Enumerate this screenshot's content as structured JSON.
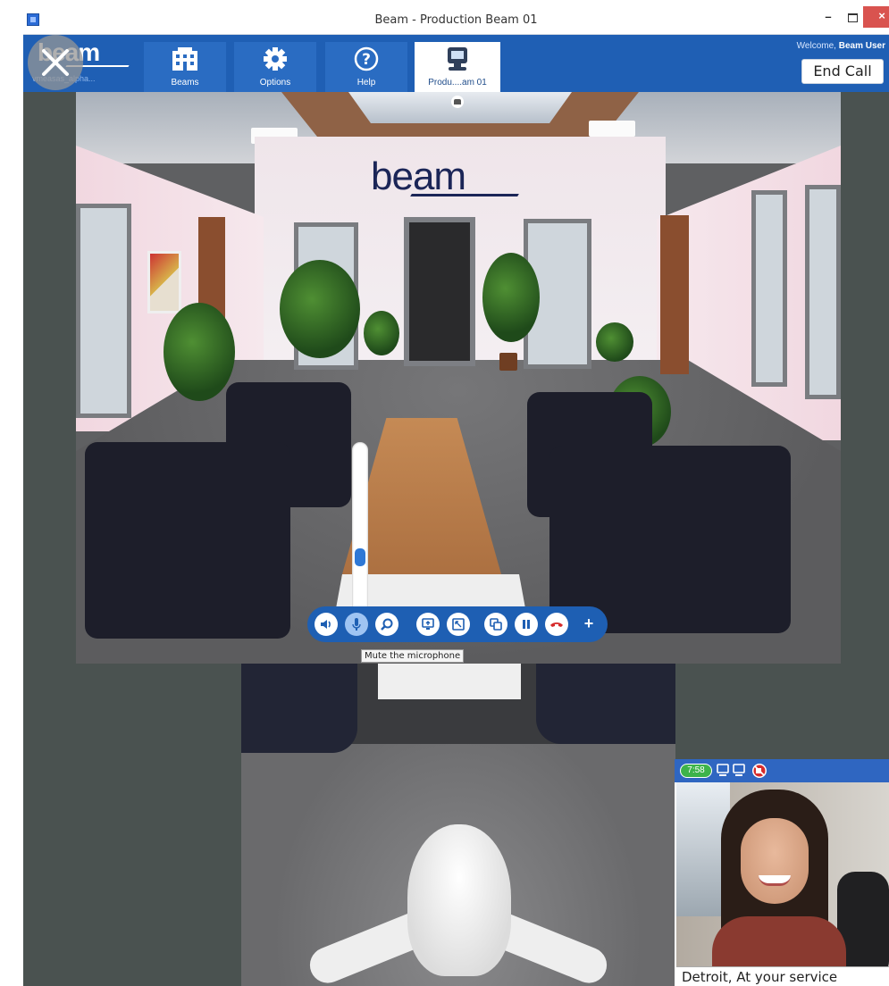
{
  "window": {
    "title": "Beam - Production Beam 01",
    "minimize": "–",
    "close": "×"
  },
  "toolbar": {
    "logo": "beam",
    "user_handle": "vmeasas_alpha...",
    "tabs": [
      {
        "label": "Beams",
        "icon": "building-icon"
      },
      {
        "label": "Options",
        "icon": "gear-icon"
      },
      {
        "label": "Help",
        "icon": "help-icon"
      },
      {
        "label": "Produ....am 01",
        "icon": "beam-robot-icon"
      }
    ],
    "welcome_prefix": "Welcome,",
    "welcome_user": "Beam User",
    "end_call_label": "End Call"
  },
  "scene": {
    "brand_sign": "beam"
  },
  "controls": {
    "mic_level": 0.33,
    "buttons": [
      {
        "name": "speaker",
        "icon": "speaker-icon"
      },
      {
        "name": "microphone",
        "icon": "microphone-icon",
        "active": true
      },
      {
        "name": "zoom",
        "icon": "zoom-icon"
      },
      {
        "name": "screen-share",
        "icon": "screen-share-icon"
      },
      {
        "name": "fullscreen",
        "icon": "fullscreen-icon"
      },
      {
        "name": "camera-swap",
        "icon": "camera-swap-icon"
      },
      {
        "name": "pause",
        "icon": "pause-icon"
      },
      {
        "name": "hang-up",
        "icon": "hang-up-icon"
      }
    ],
    "tooltip": "Mute the microphone"
  },
  "preview": {
    "timer": "7:58",
    "caption": "Detroit, At your service"
  },
  "colors": {
    "toolbar_blue": "#1f5fb4",
    "active_tab": "#ffffff",
    "timer_green": "#3db34a",
    "hangup_red": "#d62b2b"
  }
}
